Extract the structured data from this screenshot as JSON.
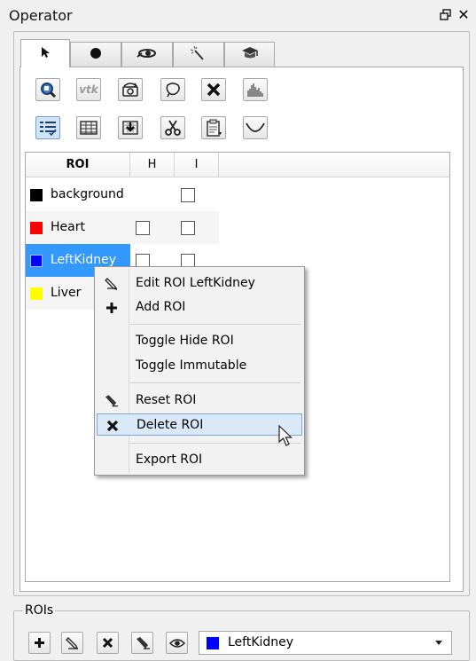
{
  "window": {
    "title": "Operator",
    "float_icon": "float-window-icon",
    "close_glyph": "✕"
  },
  "tabs": [
    {
      "icon": "pointer-icon",
      "active": true
    },
    {
      "icon": "circle-icon",
      "active": false
    },
    {
      "icon": "eye-slider-icon",
      "active": false
    },
    {
      "icon": "magic-wand-icon",
      "active": false
    },
    {
      "icon": "graduation-cap-icon",
      "active": false
    }
  ],
  "toolbar_row1": [
    "zoom-roi-icon",
    "vtk-icon",
    "camera-rotate-icon",
    "lasso-icon",
    "delete-icon",
    "histogram-icon"
  ],
  "toolbar_row1_vtk_text": "vtk",
  "toolbar_row2": [
    "roi-list-icon",
    "table-icon",
    "import-icon",
    "scissors-icon",
    "clipboard-icon",
    "curve-icon"
  ],
  "table": {
    "headers": [
      "ROI",
      "H",
      "I"
    ],
    "rows": [
      {
        "name": "background",
        "color": "#000000",
        "h_checkbox": false
      },
      {
        "name": "Heart",
        "color": "#ff0000",
        "h_checkbox": true
      },
      {
        "name": "LeftKidney",
        "color": "#0000ff",
        "h_checkbox": true,
        "selected": true
      },
      {
        "name": "Liver",
        "color": "#ffff00",
        "h_checkbox": true
      }
    ]
  },
  "context_menu": {
    "items": [
      {
        "label": "Edit ROI LeftKidney",
        "icon": "pencil-icon"
      },
      {
        "label": "Add ROI",
        "icon": "plus-icon"
      },
      {
        "label": "Toggle Hide ROI",
        "icon": ""
      },
      {
        "label": "Toggle Immutable",
        "icon": ""
      },
      {
        "label": "Reset ROI",
        "icon": "eraser-icon"
      },
      {
        "label": "Delete ROI",
        "icon": "x-icon",
        "hover": true
      },
      {
        "label": "Export ROI",
        "icon": ""
      }
    ]
  },
  "rois_group": {
    "title": "ROIs",
    "buttons": [
      "add-icon",
      "pencil-icon",
      "delete-icon",
      "eraser-icon",
      "eye-icon"
    ],
    "selected_roi": "LeftKidney",
    "selected_color": "#0000ff"
  }
}
